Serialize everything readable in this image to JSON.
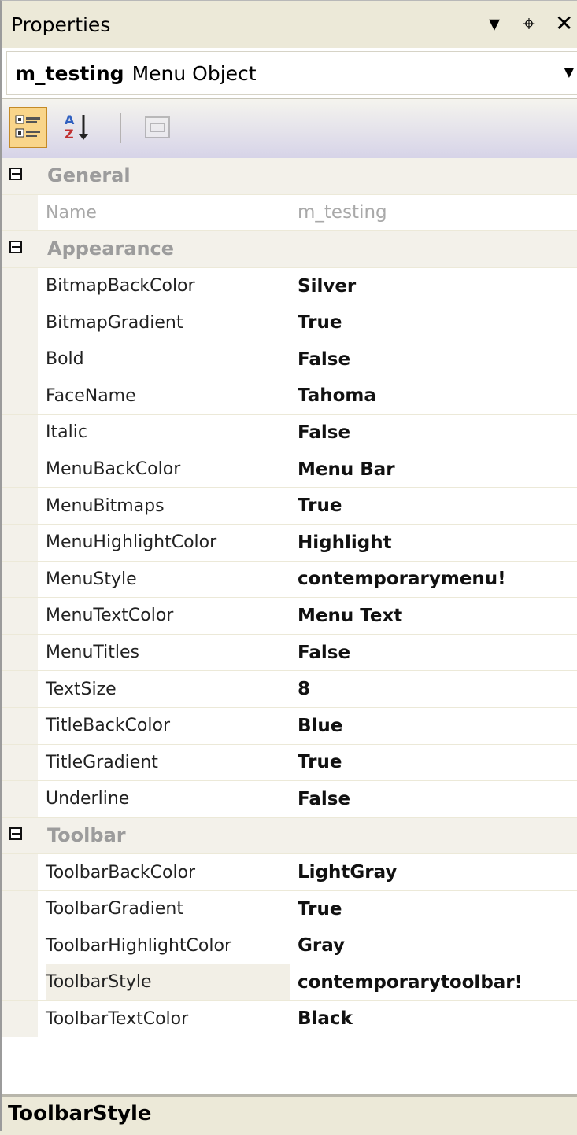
{
  "window": {
    "title": "Properties",
    "buttons": [
      "▾",
      "⌖",
      "✕"
    ]
  },
  "object": {
    "name": "m_testing",
    "type": "Menu Object"
  },
  "toolbar": {
    "buttons": [
      "categorized-icon",
      "alphabetical-icon",
      "property-pages-icon"
    ]
  },
  "categories": [
    {
      "label": "General",
      "items": [
        {
          "name": "Name",
          "value": "m_testing",
          "readonly": true
        }
      ]
    },
    {
      "label": "Appearance",
      "items": [
        {
          "name": "BitmapBackColor",
          "value": "Silver"
        },
        {
          "name": "BitmapGradient",
          "value": "True"
        },
        {
          "name": "Bold",
          "value": "False"
        },
        {
          "name": "FaceName",
          "value": "Tahoma"
        },
        {
          "name": "Italic",
          "value": "False"
        },
        {
          "name": "MenuBackColor",
          "value": "Menu Bar"
        },
        {
          "name": "MenuBitmaps",
          "value": "True"
        },
        {
          "name": "MenuHighlightColor",
          "value": "Highlight"
        },
        {
          "name": "MenuStyle",
          "value": "contemporarymenu!"
        },
        {
          "name": "MenuTextColor",
          "value": "Menu Text"
        },
        {
          "name": "MenuTitles",
          "value": "False"
        },
        {
          "name": "TextSize",
          "value": "8"
        },
        {
          "name": "TitleBackColor",
          "value": "Blue"
        },
        {
          "name": "TitleGradient",
          "value": "True"
        },
        {
          "name": "Underline",
          "value": "False"
        }
      ]
    },
    {
      "label": "Toolbar",
      "items": [
        {
          "name": "ToolbarBackColor",
          "value": "LightGray"
        },
        {
          "name": "ToolbarGradient",
          "value": "True"
        },
        {
          "name": "ToolbarHighlightColor",
          "value": "Gray"
        },
        {
          "name": "ToolbarStyle",
          "value": "contemporarytoolbar!",
          "selected": true
        },
        {
          "name": "ToolbarTextColor",
          "value": "Black"
        }
      ]
    }
  ],
  "description": {
    "title": "ToolbarStyle"
  }
}
